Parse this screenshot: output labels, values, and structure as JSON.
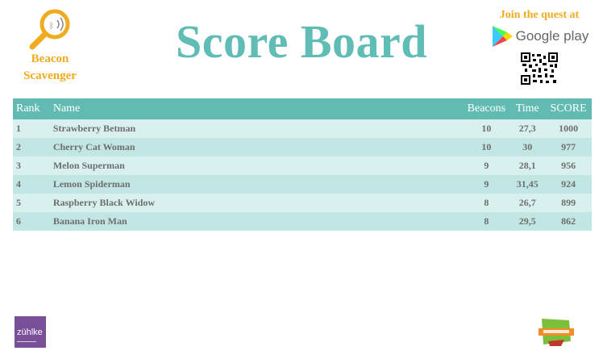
{
  "app": {
    "name_line1": "Beacon",
    "name_line2": "Scavenger",
    "logo_icon": "magnifier-beacon-icon"
  },
  "header": {
    "title": "Score Board",
    "promo_text": "Join the quest at",
    "store_label": "Google play",
    "store_icon": "google-play-icon",
    "qr_icon": "qr-code-icon"
  },
  "table": {
    "columns": {
      "rank": "Rank",
      "name": "Name",
      "beacons": "Beacons",
      "time": "Time",
      "score": "SCORE"
    },
    "rows": [
      {
        "rank": "1",
        "name": "Strawberry Betman",
        "beacons": "10",
        "time": "27,3",
        "score": "1000"
      },
      {
        "rank": "2",
        "name": "Cherry Cat Woman",
        "beacons": "10",
        "time": "30",
        "score": "977"
      },
      {
        "rank": "3",
        "name": "Melon Superman",
        "beacons": "9",
        "time": "28,1",
        "score": "956"
      },
      {
        "rank": "4",
        "name": "Lemon Spiderman",
        "beacons": "9",
        "time": "31,45",
        "score": "924"
      },
      {
        "rank": "5",
        "name": "Raspberry Black Widow",
        "beacons": "8",
        "time": "26,7",
        "score": "899"
      },
      {
        "rank": "6",
        "name": "Banana Iron Man",
        "beacons": "8",
        "time": "29,5",
        "score": "862"
      }
    ]
  },
  "footer": {
    "sponsor_logo_text": "zühlke",
    "sponsor_color": "#7a4f9a",
    "partner_icon": "partner-logo-icon"
  },
  "colors": {
    "accent": "#5fbdb6",
    "header_row": "#62bbb3",
    "brand_orange": "#f0ab1e",
    "row_light": "#d8f0ee",
    "row_dark": "#c2e6e3"
  }
}
